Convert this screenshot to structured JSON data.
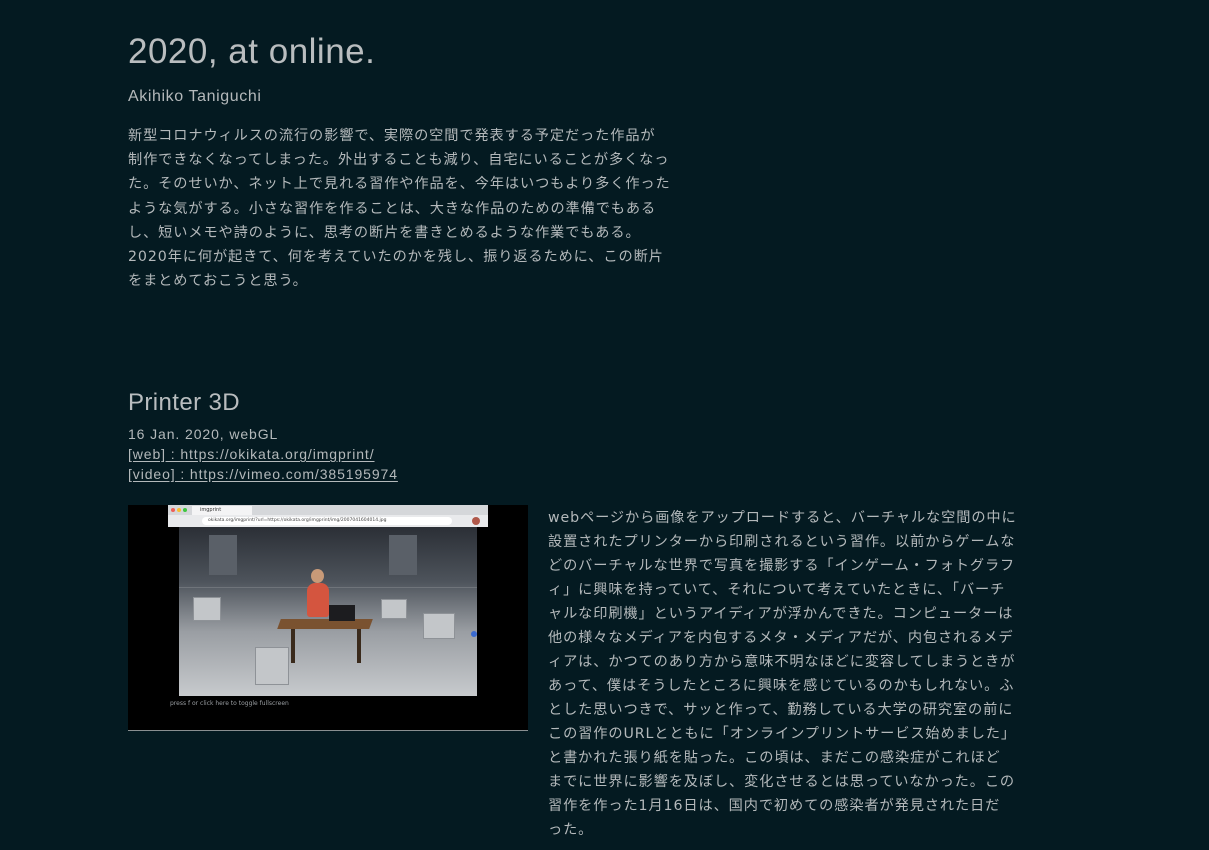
{
  "header": {
    "title": "2020, at online.",
    "author": "Akihiko Taniguchi",
    "intro_lines": [
      "新型コロナウィルスの流行の影響で、実際の空間で発表する予定だった作品が",
      "制作できなくなってしまった。外出することも減り、自宅にいることが多くなっ",
      "た。そのせいか、ネット上で見れる習作や作品を、今年はいつもより多く作った",
      "ような気がする。小さな習作を作ることは、大きな作品のための準備でもある",
      "し、短いメモや詩のように、思考の断片を書きとめるような作業でもある。",
      "2020年に何が起きて、何を考えていたのかを残し、振り返るために、この断片",
      "をまとめておこうと思う。"
    ]
  },
  "work": {
    "title": "Printer 3D",
    "meta": "16 Jan. 2020, webGL",
    "web_link": "[web] : https://okikata.org/imgprint/",
    "video_link": "[video] : https://vimeo.com/385195974",
    "thumbnail": {
      "browser_tab": "imgprint",
      "browser_url": "okikata.org/imgprint/?url=https://okikata.org/imgprint/img/2007041604014.jpg",
      "caption": "press f or click here to toggle fullscreen"
    },
    "description_lines": [
      "webページから画像をアップロードすると、バーチャルな空間の中に",
      "設置されたプリンターから印刷されるという習作。以前からゲームな",
      "どのバーチャルな世界で写真を撮影する「インゲーム・フォトグラフ",
      "ィ」に興味を持っていて、それについて考えていたときに、「バーチ",
      "ャルな印刷機」というアイディアが浮かんできた。コンピューターは",
      "他の様々なメディアを内包するメタ・メディアだが、内包されるメデ",
      "ィアは、かつてのあり方から意味不明なほどに変容してしまうときが",
      "あって、僕はそうしたところに興味を感じているのかもしれない。ふ",
      "とした思いつきで、サッと作って、勤務している大学の研究室の前に",
      "この習作のURLとともに「オンラインプリントサービス始めました」",
      "と書かれた張り紙を貼った。この頃は、まだこの感染症がこれほど",
      "までに世界に影響を及ぼし、変化させるとは思っていなかった。この",
      "習作を作った1月16日は、国内で初めての感染者が発見された日だ",
      "った。"
    ]
  },
  "colors": {
    "background": "#041a21",
    "text": "#b4b9bb",
    "title": "#b9bdbf"
  }
}
